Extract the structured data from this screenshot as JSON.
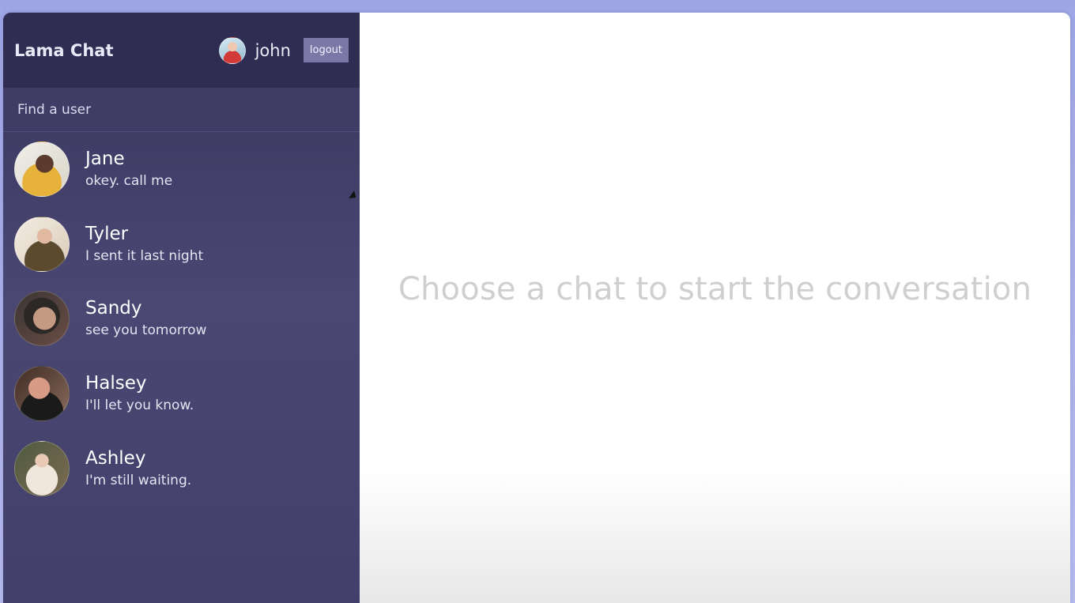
{
  "app": {
    "title": "Lama Chat"
  },
  "header": {
    "username": "john",
    "logout_label": "logout"
  },
  "search": {
    "placeholder": "Find a user",
    "value": ""
  },
  "chats": [
    {
      "name": "Jane",
      "message": "okey. call me"
    },
    {
      "name": "Tyler",
      "message": "I sent it last night"
    },
    {
      "name": "Sandy",
      "message": "see you tomorrow"
    },
    {
      "name": "Halsey",
      "message": "I'll let you know."
    },
    {
      "name": "Ashley",
      "message": "I'm still waiting."
    }
  ],
  "main": {
    "placeholder_text": "Choose a chat to start the conversation"
  },
  "colors": {
    "sidebar_bg": "#3f3c66",
    "topbar_bg": "#2f2d52",
    "logout_bg": "#7b78a8",
    "main_bg": "#ffffff",
    "placeholder_text": "#cfcfcf"
  }
}
